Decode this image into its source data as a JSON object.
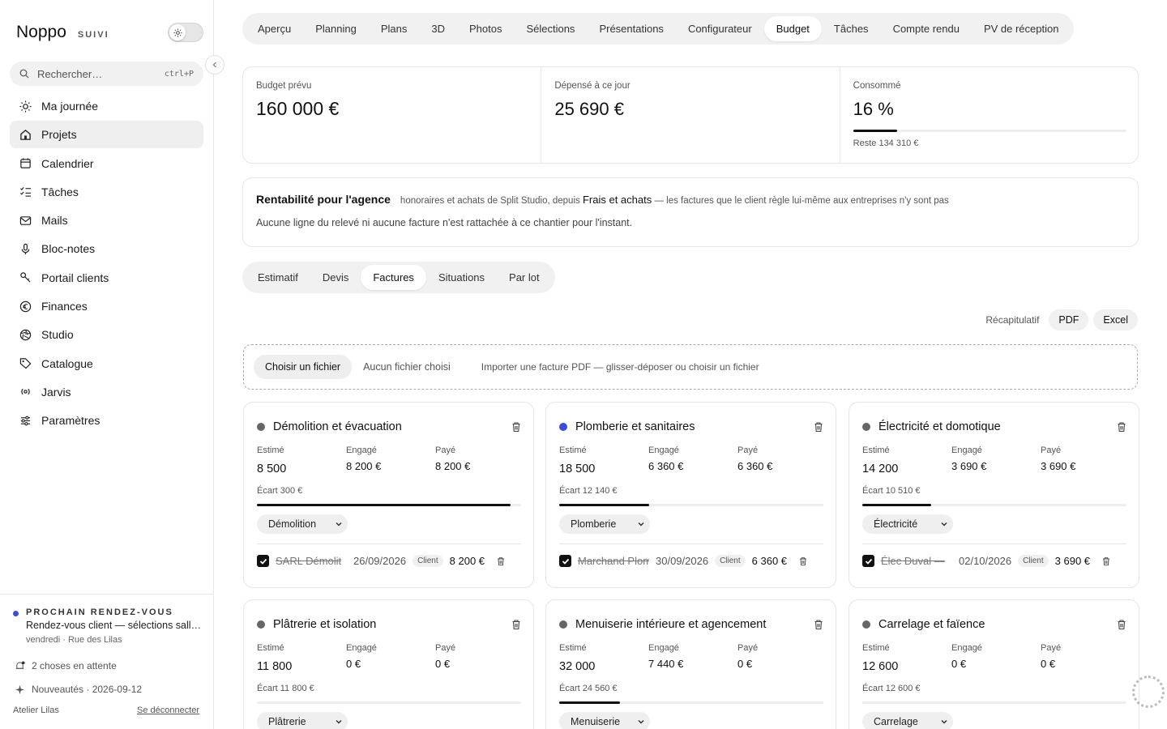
{
  "brand": {
    "name": "Noppo",
    "sub": "SUIVI"
  },
  "search": {
    "placeholder": "Rechercher…",
    "shortcut": "ctrl+P"
  },
  "nav": [
    {
      "label": "Ma journée",
      "icon": "sun-icon"
    },
    {
      "label": "Projets",
      "icon": "home-icon",
      "active": true
    },
    {
      "label": "Calendrier",
      "icon": "calendar-icon"
    },
    {
      "label": "Tâches",
      "icon": "checklist-icon"
    },
    {
      "label": "Mails",
      "icon": "mail-icon"
    },
    {
      "label": "Bloc-notes",
      "icon": "mic-icon"
    },
    {
      "label": "Portail clients",
      "icon": "key-icon"
    },
    {
      "label": "Finances",
      "icon": "euro-icon"
    },
    {
      "label": "Studio",
      "icon": "aperture-icon"
    },
    {
      "label": "Catalogue",
      "icon": "tag-icon"
    },
    {
      "label": "Jarvis",
      "icon": "radio-icon"
    },
    {
      "label": "Paramètres",
      "icon": "sliders-icon"
    }
  ],
  "sidebar_bottom": {
    "rdv_label": "PROCHAIN RENDEZ-VOUS",
    "rdv_title": "Rendez-vous client — sélections salle de bain",
    "rdv_sub": "vendredi · Rue des Lilas",
    "pending": "2 choses en attente",
    "news": "Nouveautés · 2026-09-12",
    "agency": "Atelier Lilas",
    "logout": "Se déconnecter"
  },
  "tabs": [
    "Aperçu",
    "Planning",
    "Plans",
    "3D",
    "Photos",
    "Sélections",
    "Présentations",
    "Configurateur",
    "Budget",
    "Tâches",
    "Compte rendu",
    "PV de réception"
  ],
  "active_tab": "Budget",
  "stats": {
    "planned": {
      "label": "Budget prévu",
      "value": "160 000 €"
    },
    "spent": {
      "label": "Dépensé à ce jour",
      "value": "25 690 €"
    },
    "consumed": {
      "label": "Consommé",
      "value": "16 %",
      "ratio": 0.16,
      "rest": "Reste 134 310 €"
    }
  },
  "rentabilite": {
    "title": "Rentabilité pour l'agence",
    "desc_a": "honoraires et achats de Split Studio, depuis",
    "desc_link": "Frais et achats",
    "desc_b": "— les factures que le client règle lui-même aux entreprises n'y sont pas",
    "empty": "Aucune ligne du relevé ni aucune facture n'est rattachée à ce chantier pour l'instant."
  },
  "subtabs": [
    "Estimatif",
    "Devis",
    "Factures",
    "Situations",
    "Par lot"
  ],
  "active_subtab": "Factures",
  "actions": {
    "label": "Récapitulatif",
    "pdf": "PDF",
    "excel": "Excel"
  },
  "upload": {
    "button": "Choisir un fichier",
    "status": "Aucun fichier choisi",
    "hint": "Importer une facture PDF — glisser-déposer ou choisir un fichier"
  },
  "col_labels": {
    "estime": "Estimé",
    "engage": "Engagé",
    "paye": "Payé"
  },
  "lots": [
    {
      "title": "Démolition et évacuation",
      "dot": "#666666",
      "estime": "8 500",
      "engage": "8 200 €",
      "paye": "8 200 €",
      "ecart": "Écart 300 €",
      "progress": 0.96,
      "category": "Démolition",
      "invoice": {
        "vendor": "SARL Démolit",
        "date": "26/09/2026",
        "tag": "Client",
        "amount": "8 200 €"
      }
    },
    {
      "title": "Plomberie et sanitaires",
      "dot": "#3b4fd4",
      "estime": "18 500",
      "engage": "6 360 €",
      "paye": "6 360 €",
      "ecart": "Écart 12 140 €",
      "progress": 0.34,
      "category": "Plomberie",
      "invoice": {
        "vendor": "Marchand Plomberie",
        "date": "30/09/2026",
        "tag": "Client",
        "amount": "6 360 €"
      }
    },
    {
      "title": "Électricité et domotique",
      "dot": "#666666",
      "estime": "14 200",
      "engage": "3 690 €",
      "paye": "3 690 €",
      "ecart": "Écart 10 510 €",
      "progress": 0.26,
      "category": "Électricité",
      "invoice": {
        "vendor": "Élec Duval —",
        "date": "02/10/2026",
        "tag": "Client",
        "amount": "3 690 €"
      }
    },
    {
      "title": "Plâtrerie et isolation",
      "dot": "#666666",
      "estime": "11 800",
      "engage": "0 €",
      "paye": "0 €",
      "ecart": "Écart 11 800 €",
      "progress": 0,
      "category": "Plâtrerie"
    },
    {
      "title": "Menuiserie intérieure et agencement",
      "dot": "#666666",
      "estime": "32 000",
      "engage": "7 440 €",
      "paye": "0 €",
      "ecart": "Écart 24 560 €",
      "progress": 0.23,
      "category": "Menuiserie"
    },
    {
      "title": "Carrelage et faïence",
      "dot": "#666666",
      "estime": "12 600",
      "engage": "0 €",
      "paye": "0 €",
      "ecart": "Écart 12 600 €",
      "progress": 0,
      "category": "Carrelage"
    }
  ]
}
